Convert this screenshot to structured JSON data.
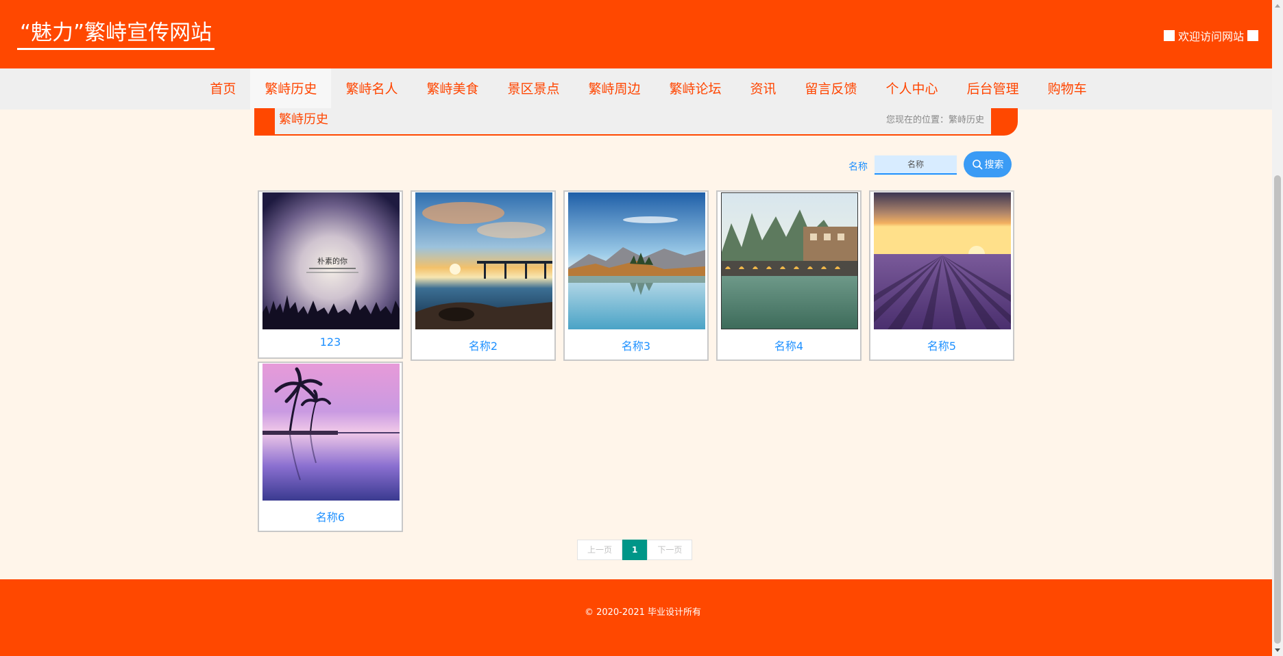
{
  "header": {
    "title": "“魅力”繁峙宣传网站",
    "welcome": "欢迎访问网站"
  },
  "nav": {
    "items": [
      {
        "label": "首页"
      },
      {
        "label": "繁峙历史",
        "active": true
      },
      {
        "label": "繁峙名人"
      },
      {
        "label": "繁峙美食"
      },
      {
        "label": "景区景点"
      },
      {
        "label": "繁峙周边"
      },
      {
        "label": "繁峙论坛"
      },
      {
        "label": "资讯"
      },
      {
        "label": "留言反馈"
      },
      {
        "label": "个人中心"
      },
      {
        "label": "后台管理"
      },
      {
        "label": "购物车"
      }
    ]
  },
  "breadcrumb": {
    "title": "繁峙历史",
    "position": "您现在的位置：繁峙历史"
  },
  "search": {
    "label": "名称",
    "placeholder": "名称",
    "button_label": "搜索"
  },
  "items": [
    {
      "name": "123",
      "image_text": "朴素的你"
    },
    {
      "name": "名称2"
    },
    {
      "name": "名称3"
    },
    {
      "name": "名称4"
    },
    {
      "name": "名称5"
    },
    {
      "name": "名称6"
    }
  ],
  "pagination": {
    "prev": "上一页",
    "current": "1",
    "next": "下一页"
  },
  "footer": {
    "copyright": "© 2020-2021 毕业设计所有"
  },
  "colors": {
    "brand": "#ff4800",
    "link": "#1e90ff",
    "page_bg": "#fff5ea",
    "pager_active": "#009688"
  }
}
